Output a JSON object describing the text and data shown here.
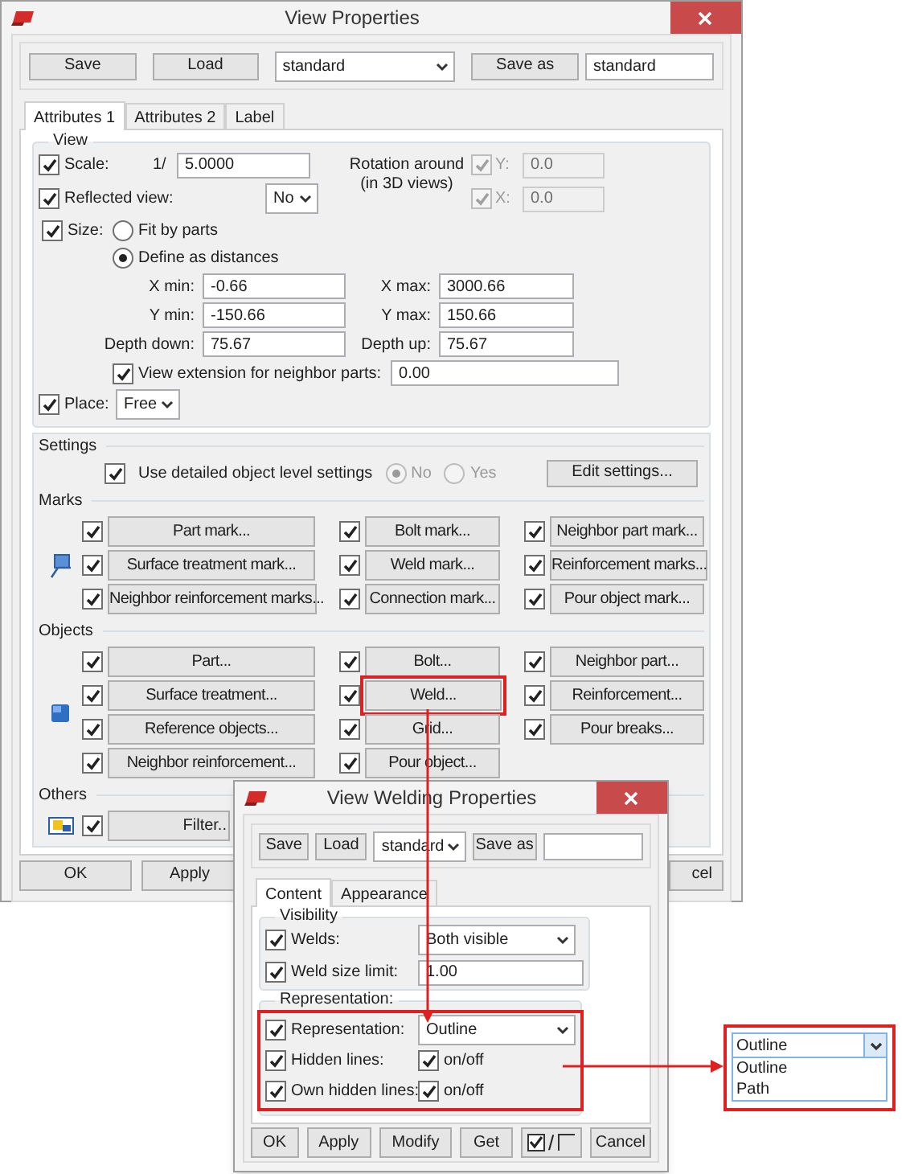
{
  "main_window": {
    "title": "View Properties",
    "toolbar": {
      "save": "Save",
      "load": "Load",
      "preset": "standard",
      "save_as": "Save as",
      "save_as_name": "standard"
    },
    "tabs": [
      {
        "label": "Attributes 1",
        "selected": true
      },
      {
        "label": "Attributes 2",
        "selected": false
      },
      {
        "label": "Label",
        "selected": false
      }
    ],
    "view": {
      "title": "View",
      "scale": {
        "label": "Scale:",
        "checked": true,
        "prefix": "1/",
        "value": "5.0000"
      },
      "rotation": {
        "label": "Rotation around",
        "sublabel": "(in 3D views)",
        "disabled": true,
        "axes": [
          {
            "label": "Y:",
            "checked": true,
            "value": "0.0"
          },
          {
            "label": "X:",
            "checked": true,
            "value": "0.0"
          }
        ]
      },
      "reflected": {
        "label": "Reflected view:",
        "checked": true,
        "value": "No"
      },
      "size": {
        "label": "Size:",
        "checked": true,
        "options": [
          {
            "label": "Fit by parts",
            "selected": false
          },
          {
            "label": "Define as distances",
            "selected": true
          }
        ],
        "fields": [
          {
            "label": "X min:",
            "value": "-0.66"
          },
          {
            "label": "X max:",
            "value": "3000.66"
          },
          {
            "label": "Y min:",
            "value": "-150.66"
          },
          {
            "label": "Y max:",
            "value": "150.66"
          },
          {
            "label": "Depth down:",
            "value": "75.67"
          },
          {
            "label": "Depth up:",
            "value": "75.67"
          }
        ]
      },
      "extension": {
        "label": "View extension for neighbor parts:",
        "checked": true,
        "value": "0.00"
      },
      "place": {
        "label": "Place:",
        "checked": true,
        "value": "Free"
      }
    },
    "settings": {
      "title": "Settings",
      "detailed": {
        "label": "Use detailed object level settings",
        "checked": true
      },
      "disabled": true,
      "options": [
        {
          "label": "No",
          "selected": true
        },
        {
          "label": "Yes",
          "selected": false
        }
      ],
      "edit": "Edit settings..."
    },
    "marks": {
      "title": "Marks",
      "items": [
        {
          "label": "Part mark...",
          "checked": true,
          "highlighted": false
        },
        {
          "label": "Bolt mark...",
          "checked": true,
          "highlighted": false
        },
        {
          "label": "Neighbor part mark...",
          "checked": true,
          "highlighted": false
        },
        {
          "label": "Surface treatment mark...",
          "checked": true,
          "highlighted": false
        },
        {
          "label": "Weld mark...",
          "checked": true,
          "highlighted": false
        },
        {
          "label": "Reinforcement marks...",
          "checked": true,
          "highlighted": false
        },
        {
          "label": "Neighbor reinforcement marks...",
          "checked": true,
          "highlighted": false
        },
        {
          "label": "Connection mark...",
          "checked": true,
          "highlighted": false
        },
        {
          "label": "Pour object mark...",
          "checked": true,
          "highlighted": false
        }
      ]
    },
    "objects": {
      "title": "Objects",
      "items": [
        {
          "label": "Part...",
          "checked": true,
          "highlighted": false
        },
        {
          "label": "Bolt...",
          "checked": true,
          "highlighted": false
        },
        {
          "label": "Neighbor part...",
          "checked": true,
          "highlighted": false
        },
        {
          "label": "Surface treatment...",
          "checked": true,
          "highlighted": false
        },
        {
          "label": "Weld...",
          "checked": true,
          "highlighted": true
        },
        {
          "label": "Reinforcement...",
          "checked": true,
          "highlighted": false
        },
        {
          "label": "Reference objects...",
          "checked": true,
          "highlighted": false
        },
        {
          "label": "Grid...",
          "checked": true,
          "highlighted": false
        },
        {
          "label": "Pour breaks...",
          "checked": true,
          "highlighted": false
        },
        {
          "label": "Neighbor reinforcement...",
          "checked": true,
          "highlighted": false
        },
        {
          "label": "Pour object...",
          "checked": true,
          "highlighted": false
        }
      ]
    },
    "others": {
      "title": "Others",
      "items": [
        {
          "label": "Filter..",
          "checked": true,
          "highlighted": false
        }
      ]
    },
    "buttons": [
      "OK",
      "Apply",
      "cel"
    ]
  },
  "welding_dialog": {
    "title": "View Welding Properties",
    "toolbar": {
      "save": "Save",
      "load": "Load",
      "preset": "standard",
      "save_as": "Save as"
    },
    "tabs": [
      {
        "label": "Content",
        "selected": true
      },
      {
        "label": "Appearance",
        "selected": false
      }
    ],
    "visibility": {
      "title": "Visibility",
      "rows": [
        {
          "kind": "dropdown",
          "label": "Welds:",
          "checked": true,
          "value": "Both visible"
        },
        {
          "kind": "input",
          "label": "Weld size limit:",
          "checked": true,
          "value": "1.00"
        }
      ]
    },
    "representation": {
      "title": "Representation:",
      "highlighted": true,
      "rows": [
        {
          "kind": "dropdown",
          "label": "Representation:",
          "checked": true,
          "value": "Outline"
        },
        {
          "kind": "toggle",
          "label": "Hidden lines:",
          "checked": true,
          "option": "on/off",
          "option_checked": true
        },
        {
          "kind": "toggle",
          "label": "Own hidden lines:",
          "checked": true,
          "option": "on/off",
          "option_checked": true
        }
      ]
    },
    "buttons": [
      "OK",
      "Apply",
      "Modify",
      "Get"
    ],
    "toggle_separator": "/",
    "cancel": "Cancel"
  },
  "dropdown_popup": {
    "highlighted": true,
    "value": "Outline",
    "options": [
      "Outline",
      "Path"
    ]
  }
}
